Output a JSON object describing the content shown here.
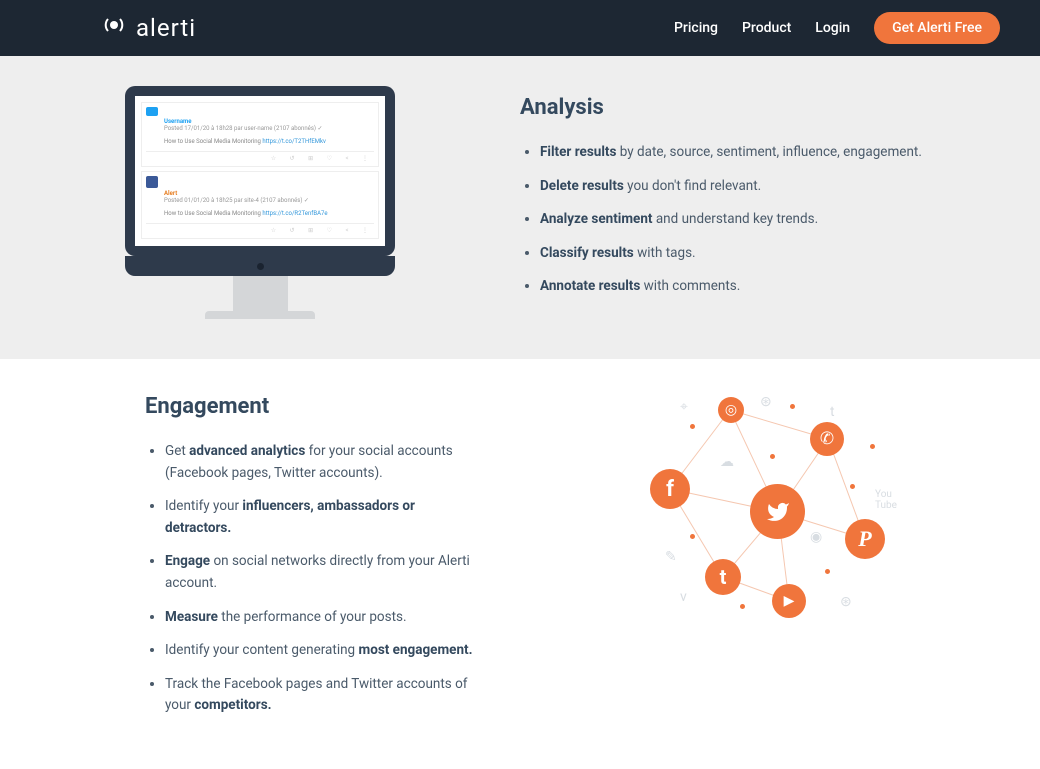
{
  "header": {
    "brand": "alerti",
    "nav": {
      "pricing": "Pricing",
      "product": "Product",
      "login": "Login",
      "cta": "Get Alerti Free"
    }
  },
  "analysis": {
    "heading": "Analysis",
    "items": [
      {
        "strong": "Filter results",
        "rest": " by date, source, sentiment, influence, engagement."
      },
      {
        "strong": "Delete results",
        "rest": " you don't find relevant."
      },
      {
        "strong": "Analyze sentiment",
        "rest": " and understand key trends."
      },
      {
        "strong": "Classify results",
        "rest": " with tags."
      },
      {
        "strong": "Annotate results",
        "rest": " with comments."
      }
    ]
  },
  "engagement": {
    "heading": "Engagement",
    "items": [
      {
        "pre": "Get ",
        "strong": "advanced analytics",
        "rest": " for your social accounts (Facebook pages, Twitter accounts)."
      },
      {
        "pre": "Identify your ",
        "strong": "influencers, ambassadors or detractors.",
        "rest": ""
      },
      {
        "pre": "",
        "strong": "Engage",
        "rest": " on social networks directly from your Alerti account."
      },
      {
        "pre": "",
        "strong": "Measure",
        "rest": " the performance of your posts."
      },
      {
        "pre": "Identify your content generating ",
        "strong": "most engagement.",
        "rest": ""
      },
      {
        "pre": "Track the Facebook pages and Twitter accounts of your ",
        "strong": "competitors.",
        "rest": ""
      }
    ]
  },
  "monitor": {
    "feed1_title": "Username",
    "feed1_meta": "Posted 17/01/20 à 18h28 par user-name (2107 abonnés) ✓",
    "feed1_text": "How to Use Social Media Monitoring ",
    "feed1_link": "https://t.co/T2THfEMkv",
    "feed2_title": "Alert",
    "feed2_meta": "Posted 01/01/20 à 18h25 par site-4 (2107 abonnés) ✓",
    "feed2_text": "How to Use Social Media Monitoring ",
    "feed2_link": "https://t.co/R2TenfBA7e",
    "actions": "☆ ↺ ⊞ ♡ < ⋮"
  }
}
